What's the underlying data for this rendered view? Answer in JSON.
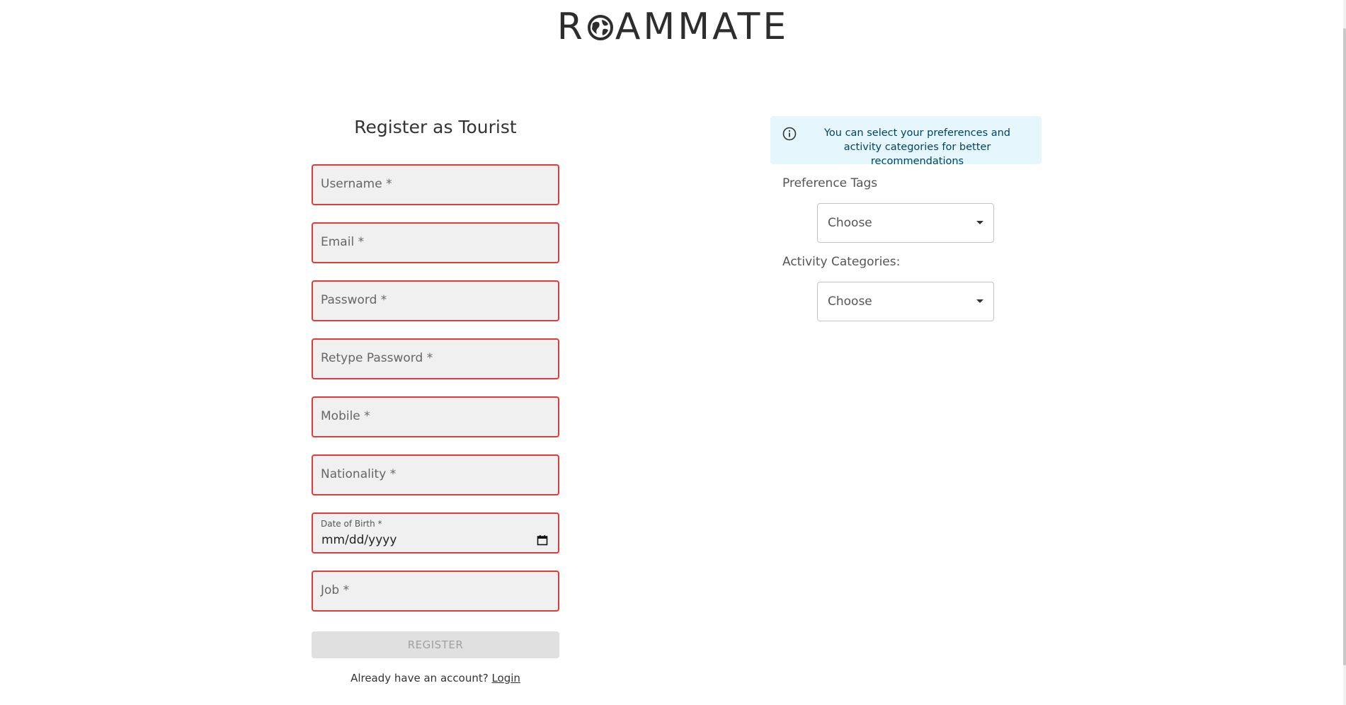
{
  "logo": {
    "before": "R",
    "after": "AMMATE"
  },
  "form": {
    "title": "Register as Tourist",
    "fields": {
      "username": "Username *",
      "email": "Email *",
      "password": "Password *",
      "retype_password": "Retype Password *",
      "mobile": "Mobile *",
      "nationality": "Nationality *",
      "dob_label": "Date of Birth *",
      "dob_value": "mm/dd/yyyy",
      "job": "Job *"
    },
    "register_label": "REGISTER",
    "already_text": "Already have an account?",
    "login_label": "Login"
  },
  "right": {
    "info_text": "You can select your preferences and activity categories for better recommendations",
    "preference_label": "Preference Tags",
    "preference_value": "Choose",
    "activity_label": "Activity Categories:",
    "activity_value": "Choose"
  },
  "colors": {
    "error_border": "#e53935",
    "info_bg": "#e5f6fd",
    "field_bg": "#f0f0f0"
  }
}
